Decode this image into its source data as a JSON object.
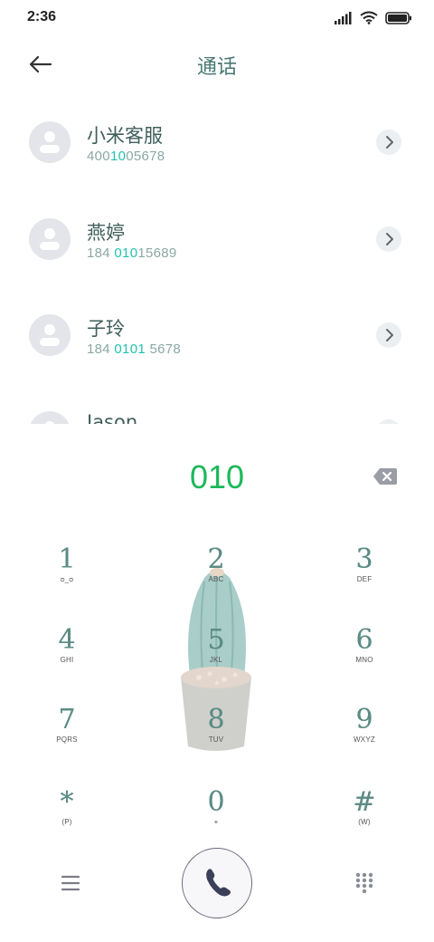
{
  "status": {
    "time": "2:36"
  },
  "header": {
    "title": "通话"
  },
  "contacts": [
    {
      "name": "小米客服",
      "number_parts": [
        "400",
        "10",
        "05678"
      ],
      "highlight_index": 1
    },
    {
      "name": "燕婷",
      "number_parts": [
        "184 ",
        "010",
        "15689"
      ],
      "highlight_index": 1
    },
    {
      "name": "子玲",
      "number_parts": [
        "184 ",
        "0101",
        " 5678"
      ],
      "highlight_index": 1
    },
    {
      "name": "Jason",
      "number_parts": [
        "",
        "",
        ""
      ],
      "highlight_index": 1
    }
  ],
  "dialer": {
    "input": "010"
  },
  "keys": [
    {
      "digit": "1",
      "sub": "ᴑ_ᴑ"
    },
    {
      "digit": "2",
      "sub": "ABC"
    },
    {
      "digit": "3",
      "sub": "DEF"
    },
    {
      "digit": "4",
      "sub": "GHI"
    },
    {
      "digit": "5",
      "sub": "JKL"
    },
    {
      "digit": "6",
      "sub": "MNO"
    },
    {
      "digit": "7",
      "sub": "PQRS"
    },
    {
      "digit": "8",
      "sub": "TUV"
    },
    {
      "digit": "9",
      "sub": "WXYZ"
    },
    {
      "digit": "*",
      "sub": "(P)"
    },
    {
      "digit": "0",
      "sub": "+"
    },
    {
      "digit": "#",
      "sub": "(W)"
    }
  ],
  "colors": {
    "accent_green": "#1bb85a",
    "highlight_teal": "#20c3b0",
    "title_teal": "#4a7a72"
  },
  "icons": {
    "back": "arrow-left-icon",
    "chevron": "chevron-right-icon",
    "backspace": "backspace-icon",
    "menu": "menu-icon",
    "call": "phone-icon",
    "dialpad": "dialpad-icon"
  }
}
